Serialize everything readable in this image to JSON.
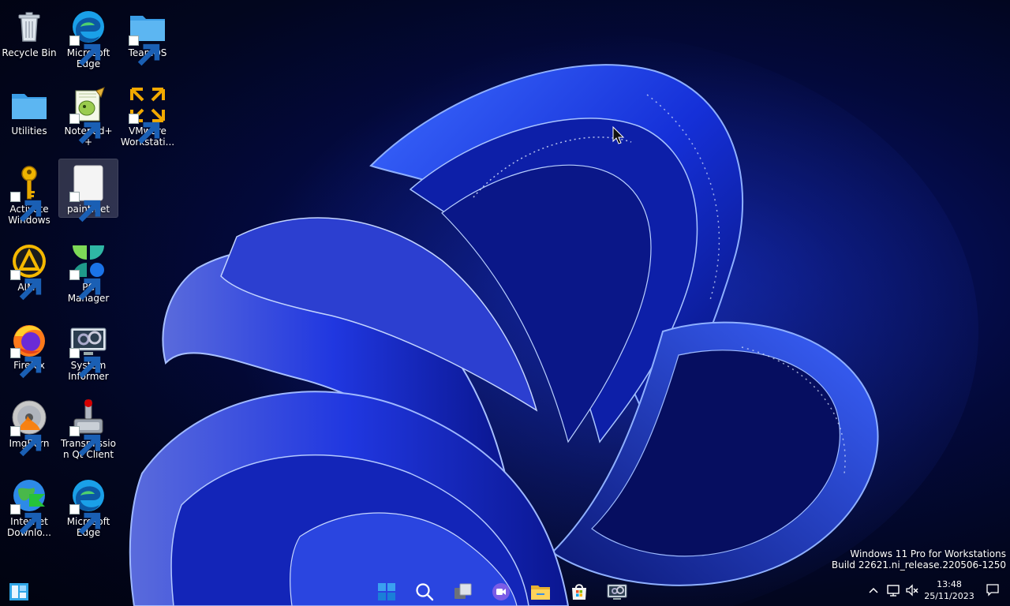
{
  "desktop": {
    "icons": [
      {
        "label": "Recycle Bin",
        "icon": "recycle-bin-icon",
        "shortcut": false
      },
      {
        "label": "Microsoft Edge",
        "icon": "edge-icon",
        "shortcut": true
      },
      {
        "label": "TeamOS",
        "icon": "folder-icon",
        "shortcut": true
      },
      {
        "label": "Utilities",
        "icon": "folder-icon",
        "shortcut": false
      },
      {
        "label": "Notepad++",
        "icon": "notepad-plus-plus-icon",
        "shortcut": true
      },
      {
        "label": "VMware Workstati...",
        "icon": "vmware-icon",
        "shortcut": true
      },
      {
        "label": "Activate Windows",
        "icon": "key-icon",
        "shortcut": true
      },
      {
        "label": "paint.net",
        "icon": "paintnet-icon",
        "shortcut": true,
        "selected": true
      },
      {
        "label": "AIMP",
        "icon": "aimp-icon",
        "shortcut": true
      },
      {
        "label": "PC Manager",
        "icon": "pc-manager-icon",
        "shortcut": true
      },
      {
        "label": "Firefox",
        "icon": "firefox-icon",
        "shortcut": true
      },
      {
        "label": "System Informer",
        "icon": "system-informer-icon",
        "shortcut": true
      },
      {
        "label": "ImgBurn",
        "icon": "imgburn-icon",
        "shortcut": true
      },
      {
        "label": "Transmission Qt Client",
        "icon": "transmission-icon",
        "shortcut": true
      },
      {
        "label": "Internet Downlo...",
        "icon": "internet-download-manager-icon",
        "shortcut": true
      },
      {
        "label": "Microsoft Edge",
        "icon": "edge-icon",
        "shortcut": true
      }
    ]
  },
  "watermark": {
    "line1": "Windows 11 Pro for Workstations",
    "line2": "Build 22621.ni_release.220506-1250"
  },
  "taskbar": {
    "widgets_icon": "widgets-icon",
    "apps": [
      "start-icon",
      "search-icon",
      "task-view-icon",
      "chat-icon",
      "file-explorer-icon",
      "microsoft-store-icon",
      "system-informer-icon"
    ],
    "tray": [
      "chevron-up-icon",
      "network-icon",
      "volume-muted-icon"
    ],
    "time": "13:48",
    "date": "25/11/2023",
    "notification_icon": "notification-icon"
  },
  "colors": {
    "accent": "#0078d4",
    "wallpaper_dark": "#02061f",
    "wallpaper_blue": "#1a3cff"
  }
}
